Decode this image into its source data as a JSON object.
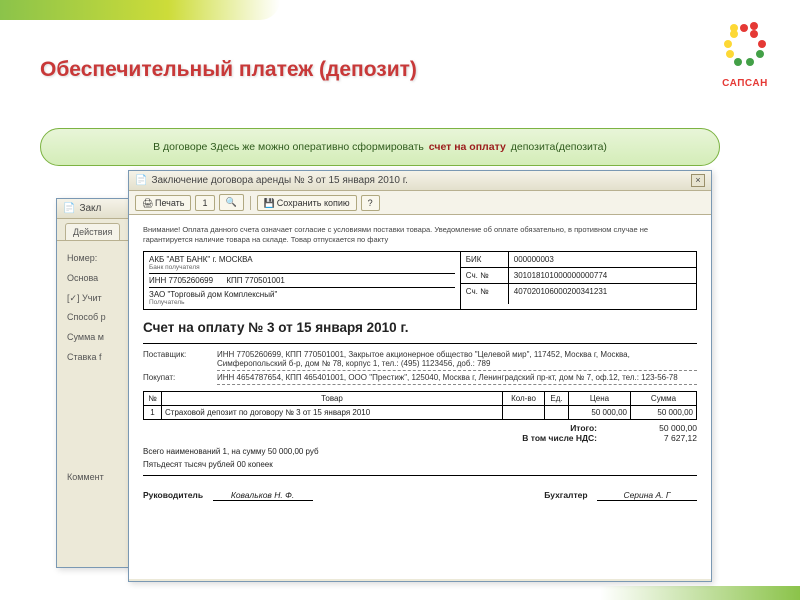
{
  "brand": {
    "name": "САПСАН"
  },
  "page": {
    "title": "Обеспечительный платеж (депозит)"
  },
  "banner": {
    "prefix": "В договоре",
    "mid": "Здесь же можно оперативно сформировать",
    "hl": "счет на оплату",
    "suffix": "депозита(депозита)"
  },
  "back_window": {
    "title": "Закл",
    "toolbar_label": "Действия",
    "fields": [
      "Номер:",
      "Основа",
      "[✓] Учит",
      "Способ р",
      "Сумма м",
      "Ставка f"
    ],
    "comment_label": "Коммент"
  },
  "front_window": {
    "title": "Заключение договора аренды № 3 от 15 января 2010 г.",
    "toolbar": {
      "print": "Печать",
      "copies": "1",
      "save": "Сохранить копию"
    }
  },
  "invoice": {
    "note": "Внимание! Оплата данного счета означает согласие с условиями поставки товара. Уведомление об оплате обязательно, в противном случае не гарантируется наличие товара на складе. Товар отпускается по факту",
    "bank": {
      "name": "АКБ \"АВТ БАНК\" г. МОСКВА",
      "recipient_label": "Банк получателя",
      "inn": "7705260699",
      "inn_label": "ИНН",
      "kpp": "770501001",
      "kpp_label": "КПП",
      "payer": "ЗАО \"Торговый дом Комплексный\"",
      "payer_label": "Получатель",
      "bik_label": "БИК",
      "bik": "000000003",
      "acc_label": "Сч. №",
      "acc1": "301018101000000000774",
      "acc2": "407020106000200341231"
    },
    "title": "Счет на оплату № 3 от 15 января 2010 г.",
    "supplier_label": "Поставщик:",
    "supplier": "ИНН 7705260699, КПП 770501001, Закрытое акционерное общество \"Целевой мир\", 117452, Москва г, Москва, Симферопольский б-р, дом № 78, корпус 1, тел.: (495) 1123456, доб.: 789",
    "buyer_label": "Покупат:",
    "buyer": "ИНН 4654787654, КПП 465401001, ООО \"Престиж\", 125040, Москва г, Ленинградский пр-кт, дом № 7, оф.12, тел.: 123-56-78",
    "table": {
      "headers": [
        "№",
        "Товар",
        "Кол-во",
        "Ед.",
        "Цена",
        "Сумма"
      ],
      "rows": [
        {
          "n": "1",
          "item": "Страховой депозит по договору № 3 от 15 января 2010",
          "qty": "",
          "unit": "",
          "price": "50 000,00",
          "sum": "50 000,00"
        }
      ]
    },
    "totals": {
      "total_label": "Итого:",
      "total": "50 000,00",
      "vat_label": "В том числе НДС:",
      "vat": "7 627,12"
    },
    "sum_line": "Всего наименований 1, на сумму 50 000,00 руб",
    "sum_words": "Пятьдесят тысяч рублей 00 копеек",
    "sig": {
      "director": "Руководитель",
      "director_name": "Ковальков Н. Ф.",
      "accountant": "Бухгалтер",
      "accountant_name": "Серина А. Г"
    }
  }
}
